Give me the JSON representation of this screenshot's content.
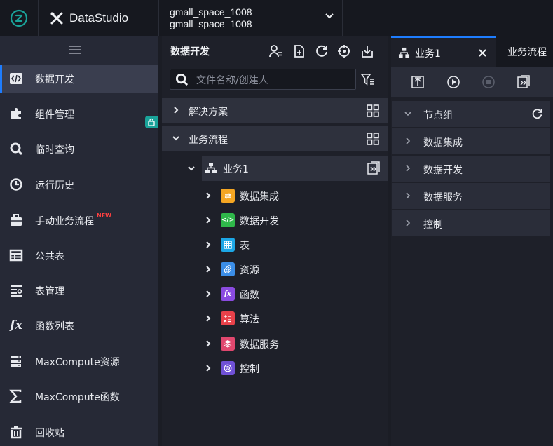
{
  "header": {
    "brand": "DataStudio",
    "workspace_line1": "gmall_space_1008",
    "workspace_line2": "gmall_space_1008"
  },
  "sidebar": {
    "items": [
      {
        "label": "数据开发",
        "icon": "code-icon",
        "active": true
      },
      {
        "label": "组件管理",
        "icon": "puzzle-icon"
      },
      {
        "label": "临时查询",
        "icon": "search-icon"
      },
      {
        "label": "运行历史",
        "icon": "clock-icon"
      },
      {
        "label": "手动业务流程",
        "icon": "briefcase-icon",
        "badge": "NEW"
      },
      {
        "label": "公共表",
        "icon": "table-icon"
      },
      {
        "label": "表管理",
        "icon": "table-manage-icon"
      },
      {
        "label": "函数列表",
        "icon": "fx-icon"
      },
      {
        "label": "MaxCompute资源",
        "icon": "resource-icon"
      },
      {
        "label": "MaxCompute函数",
        "icon": "sigma-icon"
      },
      {
        "label": "回收站",
        "icon": "trash-icon"
      }
    ]
  },
  "middle": {
    "title": "数据开发",
    "search_placeholder": "文件名称/创建人",
    "sections": [
      {
        "label": "解决方案",
        "expanded": false
      },
      {
        "label": "业务流程",
        "expanded": true
      }
    ],
    "business_flow": "业务1",
    "tree": [
      {
        "label": "数据集成",
        "color": "#f5a623"
      },
      {
        "label": "数据开发",
        "color": "#2fb84a"
      },
      {
        "label": "表",
        "color": "#1ca7e6"
      },
      {
        "label": "资源",
        "color": "#3b8ee8"
      },
      {
        "label": "函数",
        "color": "#8a4be0"
      },
      {
        "label": "算法",
        "color": "#e8414a"
      },
      {
        "label": "数据服务",
        "color": "#e0476e"
      },
      {
        "label": "控制",
        "color": "#7051d6"
      }
    ]
  },
  "right": {
    "tab_active": "业务1",
    "tab_inactive": "业务流程",
    "node_group": "节点组",
    "nodes": [
      "数据集成",
      "数据开发",
      "数据服务",
      "控制"
    ]
  }
}
